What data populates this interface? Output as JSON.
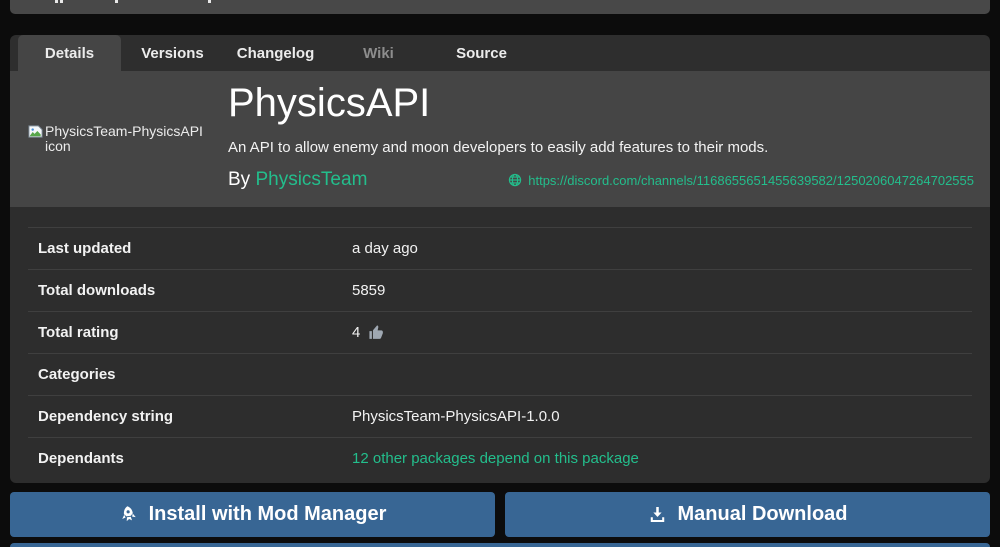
{
  "tabs": {
    "items": [
      {
        "label": "Details",
        "state": "active"
      },
      {
        "label": "Versions",
        "state": "normal"
      },
      {
        "label": "Changelog",
        "state": "normal"
      },
      {
        "label": "Wiki",
        "state": "disabled"
      },
      {
        "label": "Source",
        "state": "normal"
      }
    ]
  },
  "header": {
    "icon_alt": "PhysicsTeam-PhysicsAPI icon",
    "title": "PhysicsAPI",
    "description": "An API to allow enemy and moon developers to easily add features to their mods.",
    "by_label": "By",
    "author": "PhysicsTeam",
    "website_url": "https://discord.com/channels/1168655651455639582/1250206047264702555"
  },
  "details_table": {
    "rows": [
      {
        "label": "Last updated",
        "value": "a day ago"
      },
      {
        "label": "Total downloads",
        "value": "5859"
      },
      {
        "label": "Total rating",
        "value": "4"
      },
      {
        "label": "Categories",
        "value": ""
      },
      {
        "label": "Dependency string",
        "value": "PhysicsTeam-PhysicsAPI-1.0.0"
      },
      {
        "label": "Dependants",
        "value": "12 other packages depend on this package"
      }
    ]
  },
  "actions": {
    "install_label": "Install with Mod Manager",
    "download_label": "Manual Download"
  },
  "icons": {
    "globe": "globe-icon",
    "rocket": "rocket-icon",
    "download": "download-icon",
    "thumbs_up": "thumbs-up-icon",
    "broken_image": "broken-image-icon"
  },
  "colors": {
    "accent_green": "#23be8c",
    "button_blue": "#386694",
    "header_gray": "#454545",
    "panel_dark": "#2d2d2d",
    "tabbar_dark": "#2e2e2e",
    "page_bg": "#0c0c0c"
  }
}
